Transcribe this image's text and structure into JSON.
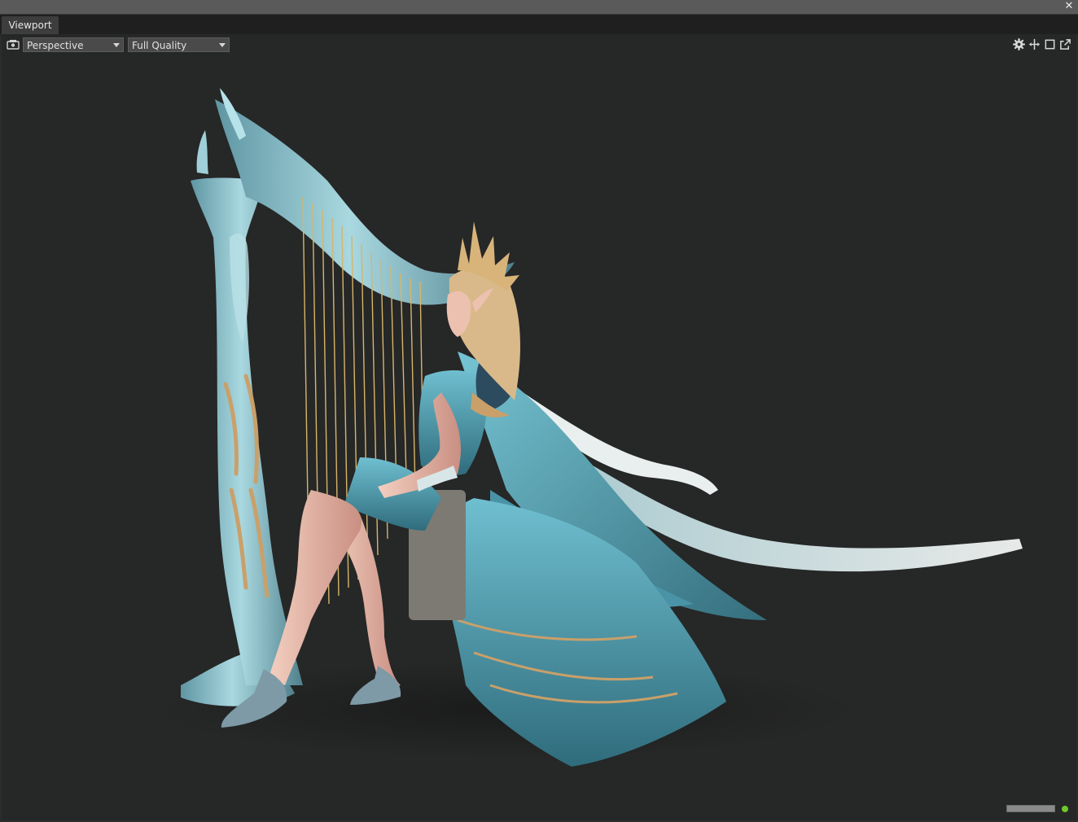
{
  "window": {
    "close_icon": "close-icon"
  },
  "tabs": [
    {
      "label": "Viewport"
    }
  ],
  "viewport": {
    "camera_icon": "camera-icon",
    "view_mode": "Perspective",
    "quality": "Full Quality",
    "toolbar_icons": [
      "gear-icon",
      "move-icon",
      "maximize-icon",
      "popout-icon"
    ],
    "status_indicator_color": "#6ec82a"
  },
  "scene": {
    "subject": "3D model of an elven harpist seated beside an ornate harp",
    "colors": {
      "background": "#262727",
      "harp": "#8fc4cf",
      "dress": "#5ba8bc",
      "gold": "#c9a06a",
      "hair": "#d9b98a",
      "skin": "#e8b7a4",
      "ribbon": "#dfe9ea"
    }
  }
}
